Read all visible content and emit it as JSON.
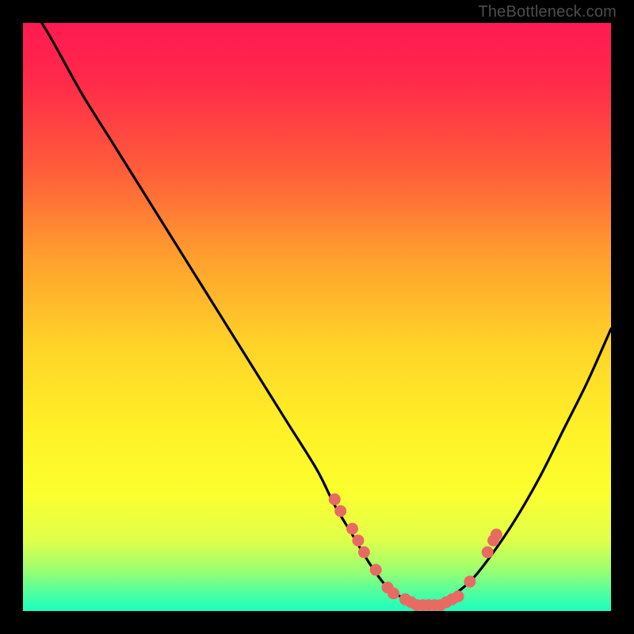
{
  "attribution": "TheBottleneck.com",
  "gradient_stops": [
    {
      "offset": 0.0,
      "color": "#ff1a52"
    },
    {
      "offset": 0.1,
      "color": "#ff2a4a"
    },
    {
      "offset": 0.25,
      "color": "#ff5d3a"
    },
    {
      "offset": 0.4,
      "color": "#ffa02e"
    },
    {
      "offset": 0.55,
      "color": "#ffd428"
    },
    {
      "offset": 0.7,
      "color": "#fff228"
    },
    {
      "offset": 0.8,
      "color": "#fbff2e"
    },
    {
      "offset": 0.88,
      "color": "#e0ff4a"
    },
    {
      "offset": 0.93,
      "color": "#9cff70"
    },
    {
      "offset": 0.97,
      "color": "#4dffa0"
    },
    {
      "offset": 1.0,
      "color": "#1affc0"
    }
  ],
  "chart_data": {
    "type": "line",
    "title": "",
    "xlabel": "",
    "ylabel": "",
    "xlim": [
      0,
      100
    ],
    "ylim": [
      0,
      100
    ],
    "series": [
      {
        "name": "bottleneck-curve",
        "x": [
          2,
          5,
          10,
          15,
          20,
          25,
          30,
          35,
          40,
          45,
          50,
          53,
          56,
          59,
          62,
          65,
          67,
          69,
          72,
          76,
          80,
          84,
          88,
          92,
          96,
          100
        ],
        "y": [
          102,
          97,
          88,
          80,
          72,
          64,
          56,
          48,
          40,
          32,
          24,
          18,
          13,
          8,
          4,
          2,
          1,
          1,
          2,
          5,
          10,
          16,
          23,
          31,
          39,
          48
        ]
      }
    ],
    "scatter_points": {
      "name": "marker-dots",
      "color": "#e86b63",
      "x": [
        53,
        54,
        56,
        57,
        58,
        60,
        62,
        63,
        65,
        66,
        67,
        68,
        69,
        70,
        71,
        72,
        73,
        74,
        76,
        79,
        80,
        80.5
      ],
      "y": [
        19,
        17,
        14,
        12,
        10,
        7,
        4,
        3,
        2,
        1.5,
        1,
        1,
        1,
        1,
        1,
        1.5,
        2,
        2.5,
        5,
        10,
        12,
        13
      ]
    }
  }
}
